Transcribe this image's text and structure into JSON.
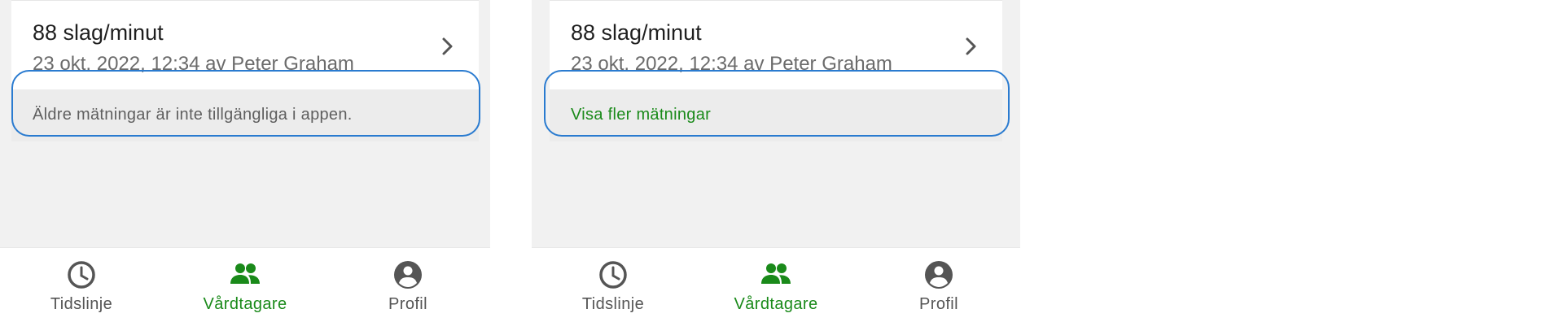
{
  "left": {
    "reading_value": "88 slag/minut",
    "reading_meta": "23 okt. 2022, 12:34 av Peter Graham",
    "notice_text": "Äldre mätningar är inte tillgängliga i appen."
  },
  "right": {
    "reading_value": "88 slag/minut",
    "reading_meta": "23 okt. 2022, 12:34 av Peter Graham",
    "notice_text": "Visa fler mätningar"
  },
  "nav": {
    "timeline_label": "Tidslinje",
    "caretakers_label": "Vårdtagare",
    "profile_label": "Profil"
  },
  "colors": {
    "accent_green": "#1a8a1a",
    "highlight_blue": "#2a7bd0",
    "panel_bg": "#f1f1f1"
  },
  "icons": {
    "timeline": "clock-icon",
    "caretakers": "people-icon",
    "profile": "account-circle-icon",
    "chevron": "chevron-right-icon"
  }
}
